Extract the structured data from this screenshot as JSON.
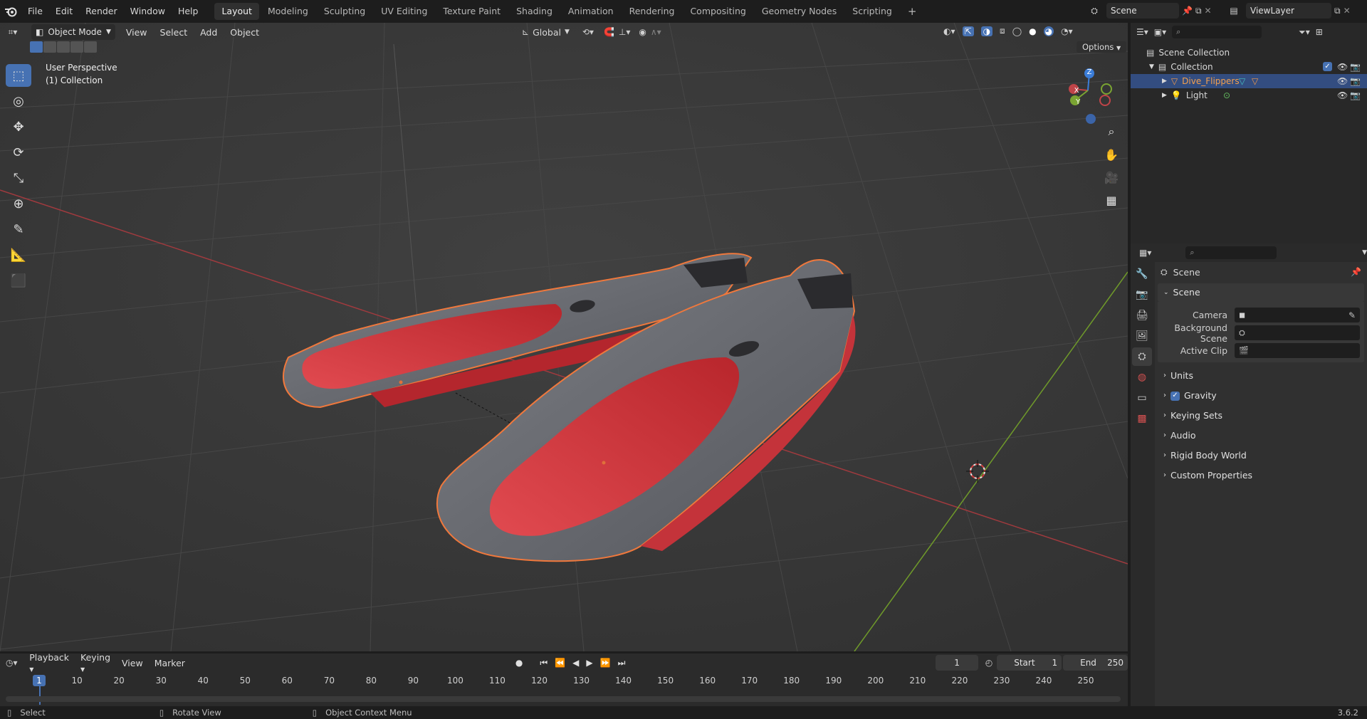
{
  "topbar": {
    "menus": [
      "File",
      "Edit",
      "Render",
      "Window",
      "Help"
    ],
    "workspaces": [
      "Layout",
      "Modeling",
      "Sculpting",
      "UV Editing",
      "Texture Paint",
      "Shading",
      "Animation",
      "Rendering",
      "Compositing",
      "Geometry Nodes",
      "Scripting"
    ],
    "active_workspace": "Layout",
    "add_tab": "+",
    "scene_name": "Scene",
    "view_layer": "ViewLayer"
  },
  "viewport_header": {
    "mode": "Object Mode",
    "menus": [
      "View",
      "Select",
      "Add",
      "Object"
    ],
    "transform_orientation": "Global",
    "options_label": "Options"
  },
  "viewport": {
    "view_name": "User Perspective",
    "collection_label": "(1) Collection",
    "gizmo_axes": [
      "X",
      "Y",
      "Z"
    ]
  },
  "outliner": {
    "root": "Scene Collection",
    "collection": "Collection",
    "items": [
      {
        "name": "Dive_Flippers",
        "selected": true
      },
      {
        "name": "Light",
        "selected": false
      }
    ]
  },
  "properties": {
    "context_title": "Scene",
    "panel_title": "Scene",
    "fields": [
      {
        "label": "Camera",
        "value": ""
      },
      {
        "label": "Background Scene",
        "value": ""
      },
      {
        "label": "Active Clip",
        "value": ""
      }
    ],
    "subpanels": [
      {
        "label": "Units",
        "checkbox": false
      },
      {
        "label": "Gravity",
        "checkbox": true
      },
      {
        "label": "Keying Sets",
        "checkbox": false
      },
      {
        "label": "Audio",
        "checkbox": false
      },
      {
        "label": "Rigid Body World",
        "checkbox": false
      },
      {
        "label": "Custom Properties",
        "checkbox": false
      }
    ]
  },
  "timeline": {
    "menus": [
      "Playback",
      "Keying",
      "View",
      "Marker"
    ],
    "current_frame": "1",
    "start_label": "Start",
    "start_value": "1",
    "end_label": "End",
    "end_value": "250",
    "ruler": [
      "1",
      "10",
      "20",
      "30",
      "40",
      "50",
      "60",
      "70",
      "80",
      "90",
      "100",
      "110",
      "120",
      "130",
      "140",
      "150",
      "160",
      "170",
      "180",
      "190",
      "200",
      "210",
      "220",
      "230",
      "240",
      "250"
    ]
  },
  "statusbar": {
    "hints": [
      "Select",
      "Rotate View",
      "Object Context Menu"
    ],
    "version": "3.6.2"
  },
  "colors": {
    "accent": "#4772b3",
    "selection_outline": "#f0783c",
    "fin_red": "#d8383e",
    "fin_grey": "#6a6c72",
    "x_axis": "#c04448",
    "y_axis": "#7aa432",
    "z_axis": "#3b7dd8"
  }
}
